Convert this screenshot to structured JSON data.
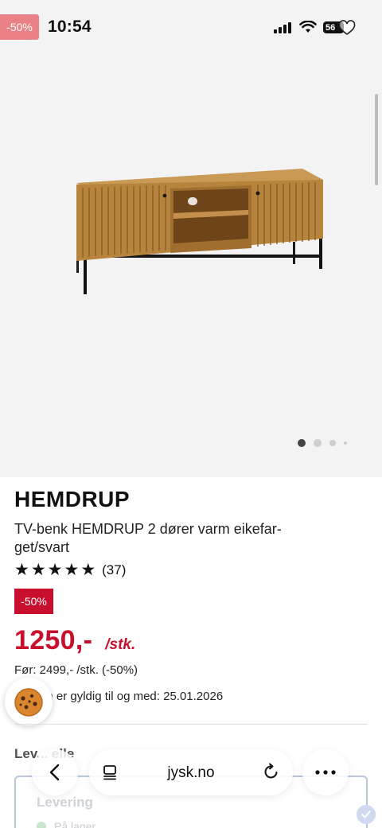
{
  "status_bar": {
    "time": "10:54",
    "battery": "56",
    "promo_tag": "-50%"
  },
  "gallery": {
    "image_alt": "TV-benk HEMDRUP",
    "image_count": 4,
    "active_index": 0
  },
  "product": {
    "brand": "HEMDRUP",
    "description": "TV-benk HEMDRUP 2 dører varm eikefar-get/svart",
    "rating": 5,
    "reviews": "(37)",
    "discount_badge": "-50%",
    "price": "1250,-",
    "price_unit": "/stk.",
    "before_price": "Før: 2499,- /stk. (-50%)",
    "valid_until": "nnjen er gyldig til og med: 25.01.2026"
  },
  "delivery": {
    "heading": "Lev... elle",
    "option_title": "Levering",
    "stock_status": "På lager"
  },
  "browser": {
    "url": "jysk.no"
  },
  "colors": {
    "sale_red": "#c8102e",
    "text": "#111111",
    "background": "#f3f3f3"
  }
}
